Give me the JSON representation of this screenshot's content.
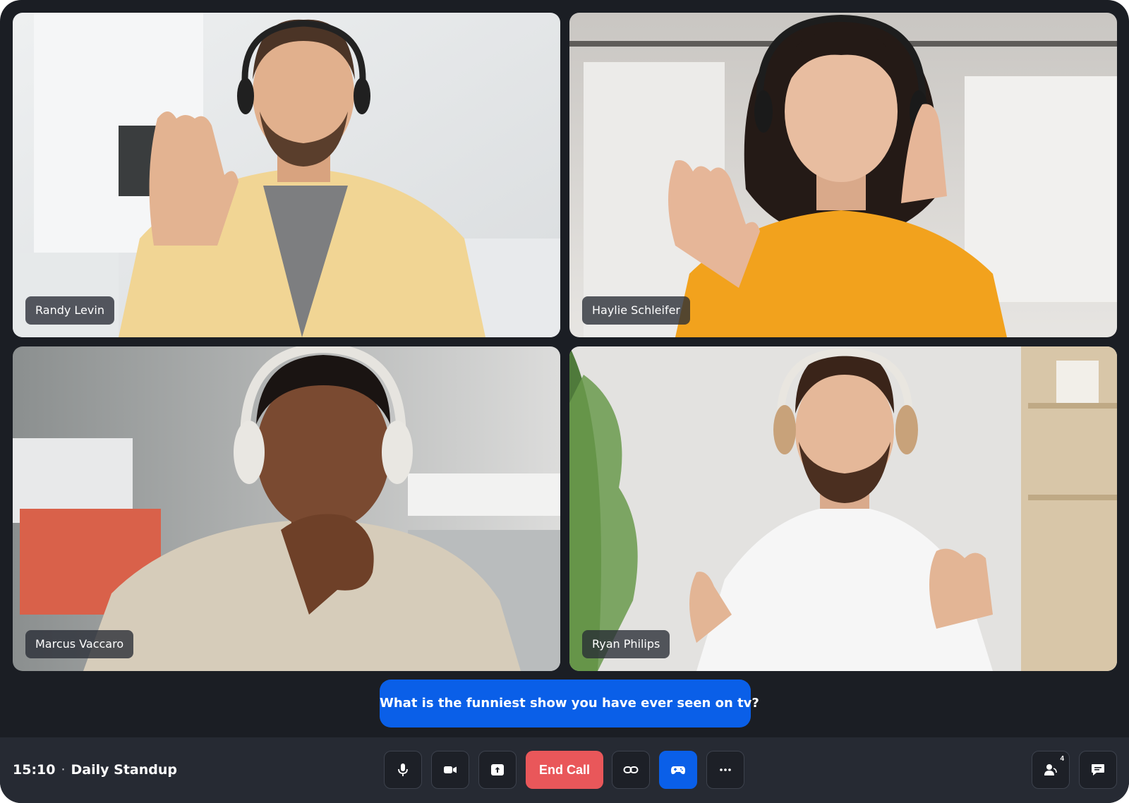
{
  "participants": [
    {
      "name": "Randy Levin"
    },
    {
      "name": "Haylie Schleifer"
    },
    {
      "name": "Marcus Vaccaro"
    },
    {
      "name": "Ryan Philips"
    }
  ],
  "caption": {
    "text": "What is the funniest show you have ever seen on tv?"
  },
  "meeting": {
    "time": "15:10",
    "separator": "·",
    "title": "Daily Standup"
  },
  "controls": {
    "end_call_label": "End Call",
    "participants_count": "4"
  },
  "colors": {
    "background": "#1b1e24",
    "toolbar": "#262a33",
    "accent_blue": "#0a5fe8",
    "end_call_red": "#e9575a"
  },
  "icons": [
    "microphone-icon",
    "camera-icon",
    "share-screen-icon",
    "link-icon",
    "gamepad-icon",
    "more-icon",
    "participants-icon",
    "chat-icon"
  ]
}
